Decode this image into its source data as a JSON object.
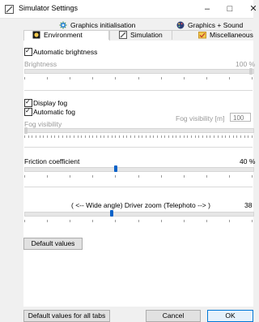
{
  "window": {
    "title": "Simulator Settings"
  },
  "tabs": {
    "row1": [
      {
        "label": "Graphics initialisation",
        "icon": "gear-icon"
      },
      {
        "label": "Graphics + Sound",
        "icon": "palette-icon"
      }
    ],
    "row2": [
      {
        "label": "Environment",
        "icon": "sun-icon",
        "active": true
      },
      {
        "label": "Simulation",
        "icon": "simulation-icon",
        "active": false
      },
      {
        "label": "Miscellaneous",
        "icon": "misc-icon",
        "active": false
      }
    ]
  },
  "brightness": {
    "auto_label": "Automatic brightness",
    "auto_checked": true,
    "label": "Brightness",
    "value_text": "100 %",
    "value": 100
  },
  "fog": {
    "display_label": "Display fog",
    "display_checked": true,
    "auto_label": "Automatic fog",
    "auto_checked": true,
    "visibility_label": "Fog visibility [m]",
    "visibility_value": "100",
    "slider_label": "Fog visibility",
    "slider_fraction": 0
  },
  "friction": {
    "label": "Friction coefficient",
    "value_text": "40 %",
    "value": 40
  },
  "zoom": {
    "label": "( <-- Wide angle)  Driver zoom  (Telephoto --> )",
    "value_text": "38",
    "slider_fraction": 0.38
  },
  "buttons": {
    "default_values": "Default values",
    "default_all": "Default values for all tabs",
    "cancel": "Cancel",
    "ok": "OK"
  },
  "colors": {
    "accent": "#0a62c8",
    "primary_border": "#0078d7"
  }
}
